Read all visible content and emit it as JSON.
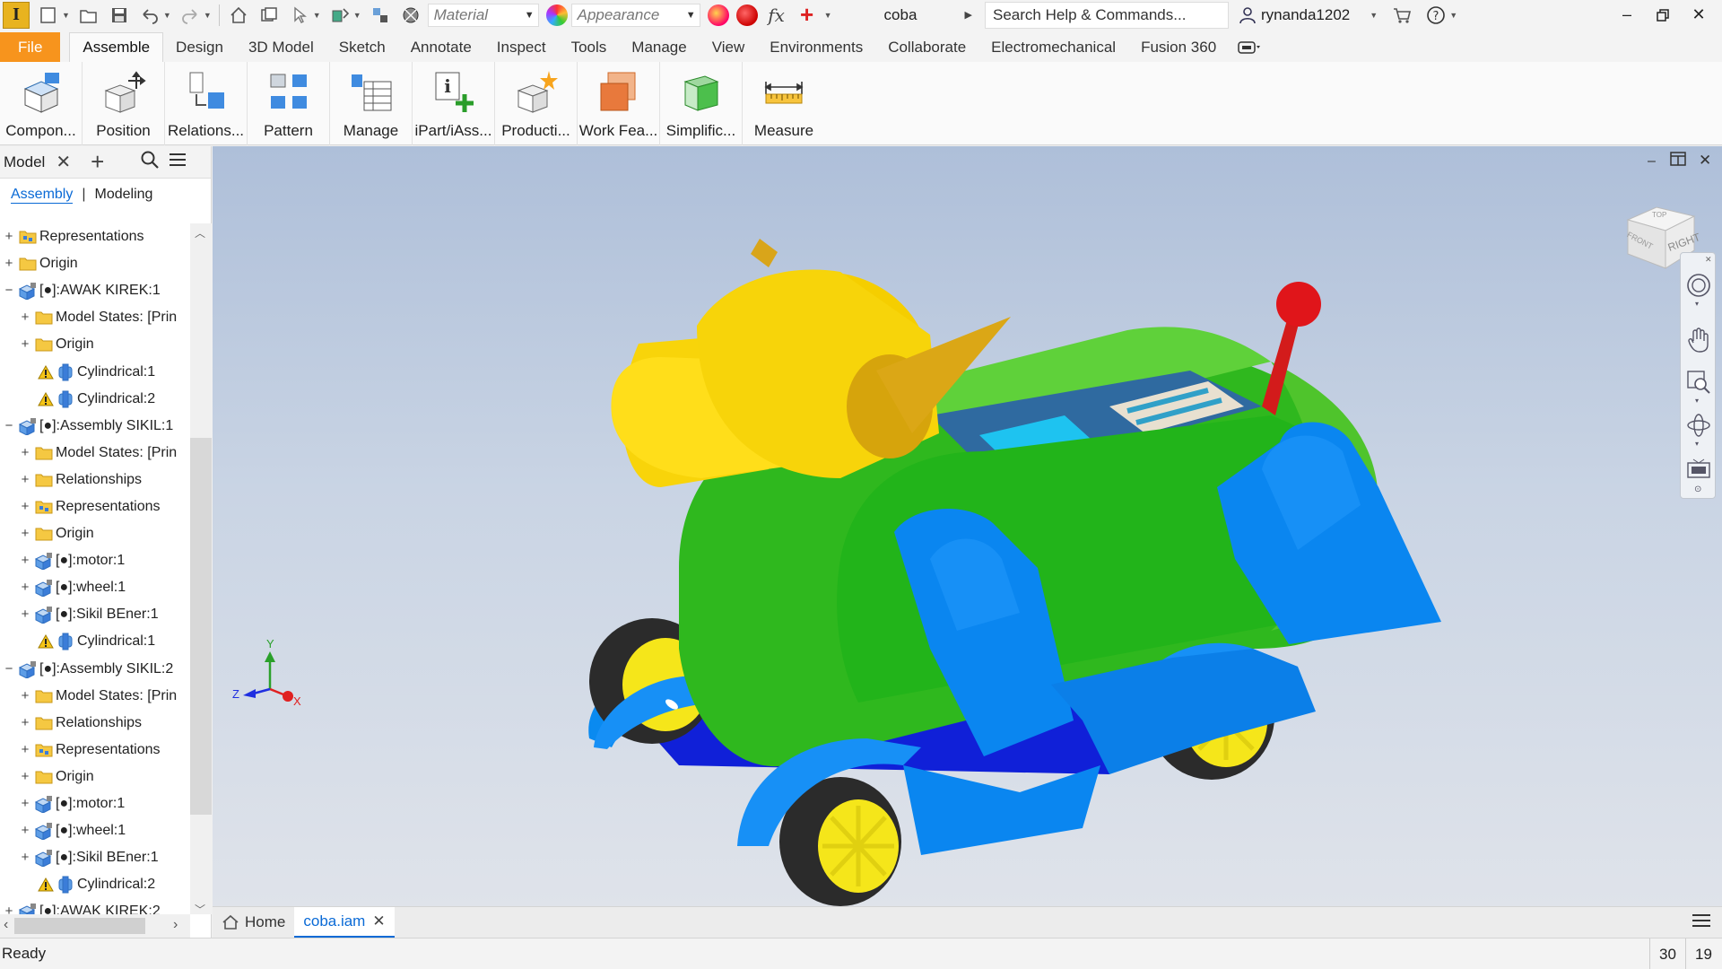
{
  "qat": {
    "material_placeholder": "Material",
    "appearance_placeholder": "Appearance",
    "document_name": "coba",
    "search_placeholder": "Search Help & Commands...",
    "user_name": "rynanda1202"
  },
  "tabs": [
    "File",
    "Assemble",
    "Design",
    "3D Model",
    "Sketch",
    "Annotate",
    "Inspect",
    "Tools",
    "Manage",
    "View",
    "Environments",
    "Collaborate",
    "Electromechanical",
    "Fusion 360"
  ],
  "active_tab": "Assemble",
  "ribbon": [
    {
      "label": "Compon...",
      "icon": "component-icon"
    },
    {
      "label": "Position",
      "icon": "position-icon"
    },
    {
      "label": "Relations...",
      "icon": "relationships-icon"
    },
    {
      "label": "Pattern",
      "icon": "pattern-icon"
    },
    {
      "label": "Manage",
      "icon": "manage-icon"
    },
    {
      "label": "iPart/iAss...",
      "icon": "ipart-icon"
    },
    {
      "label": "Producti...",
      "icon": "productivity-icon"
    },
    {
      "label": "Work Fea...",
      "icon": "work-features-icon"
    },
    {
      "label": "Simplific...",
      "icon": "simplification-icon"
    },
    {
      "label": "Measure",
      "icon": "measure-icon"
    }
  ],
  "browser": {
    "title": "Model",
    "subtab_active": "Assembly",
    "subtab_other": "Modeling",
    "tree": [
      {
        "label": "Representations",
        "depth": 0,
        "icon": "representations",
        "exp": "+"
      },
      {
        "label": "Origin",
        "depth": 0,
        "icon": "folder",
        "exp": "+"
      },
      {
        "label": "[●]:AWAK KIREK:1",
        "depth": 0,
        "icon": "assembly",
        "exp": "-"
      },
      {
        "label": "Model States: [Prin",
        "depth": 1,
        "icon": "folder",
        "exp": "+"
      },
      {
        "label": "Origin",
        "depth": 1,
        "icon": "folder",
        "exp": "+"
      },
      {
        "label": "Cylindrical:1",
        "depth": 1,
        "icon": "joint",
        "warn": true
      },
      {
        "label": "Cylindrical:2",
        "depth": 1,
        "icon": "joint",
        "warn": true
      },
      {
        "label": "[●]:Assembly SIKIL:1",
        "depth": 0,
        "icon": "assembly",
        "exp": "-"
      },
      {
        "label": "Model States: [Prin",
        "depth": 1,
        "icon": "folder",
        "exp": "+"
      },
      {
        "label": "Relationships",
        "depth": 1,
        "icon": "folder",
        "exp": "+"
      },
      {
        "label": "Representations",
        "depth": 1,
        "icon": "representations",
        "exp": "+"
      },
      {
        "label": "Origin",
        "depth": 1,
        "icon": "folder",
        "exp": "+"
      },
      {
        "label": "[●]:motor:1",
        "depth": 1,
        "icon": "assembly",
        "exp": "+"
      },
      {
        "label": "[●]:wheel:1",
        "depth": 1,
        "icon": "assembly",
        "exp": "+"
      },
      {
        "label": "[●]:Sikil BEner:1",
        "depth": 1,
        "icon": "assembly",
        "exp": "+"
      },
      {
        "label": "Cylindrical:1",
        "depth": 1,
        "icon": "joint",
        "warn": true
      },
      {
        "label": "[●]:Assembly SIKIL:2",
        "depth": 0,
        "icon": "assembly",
        "exp": "-"
      },
      {
        "label": "Model States: [Prin",
        "depth": 1,
        "icon": "folder",
        "exp": "+"
      },
      {
        "label": "Relationships",
        "depth": 1,
        "icon": "folder",
        "exp": "+"
      },
      {
        "label": "Representations",
        "depth": 1,
        "icon": "representations",
        "exp": "+"
      },
      {
        "label": "Origin",
        "depth": 1,
        "icon": "folder",
        "exp": "+"
      },
      {
        "label": "[●]:motor:1",
        "depth": 1,
        "icon": "assembly",
        "exp": "+"
      },
      {
        "label": "[●]:wheel:1",
        "depth": 1,
        "icon": "assembly",
        "exp": "+"
      },
      {
        "label": "[●]:Sikil BEner:1",
        "depth": 1,
        "icon": "assembly",
        "exp": "+"
      },
      {
        "label": "Cylindrical:2",
        "depth": 1,
        "icon": "joint",
        "warn": true
      },
      {
        "label": "[●]:AWAK KIREK:2",
        "depth": 0,
        "icon": "assembly",
        "exp": "+"
      }
    ]
  },
  "viewcube": {
    "front": "FRONT",
    "right": "RIGHT",
    "top": "TOP"
  },
  "triad": {
    "x": "X",
    "y": "Y",
    "z": "Z"
  },
  "doc_tabs": {
    "home": "Home",
    "file": "coba.iam"
  },
  "status": {
    "text": "Ready",
    "count1": "30",
    "count2": "19"
  },
  "colors": {
    "file_tab": "#f7941d",
    "accent": "#0a6ad6",
    "body_green": "#3ec61e",
    "wheel_yellow": "#f5e61a",
    "part_blue": "#0a8af0",
    "head_yellow": "#f8d40a"
  }
}
